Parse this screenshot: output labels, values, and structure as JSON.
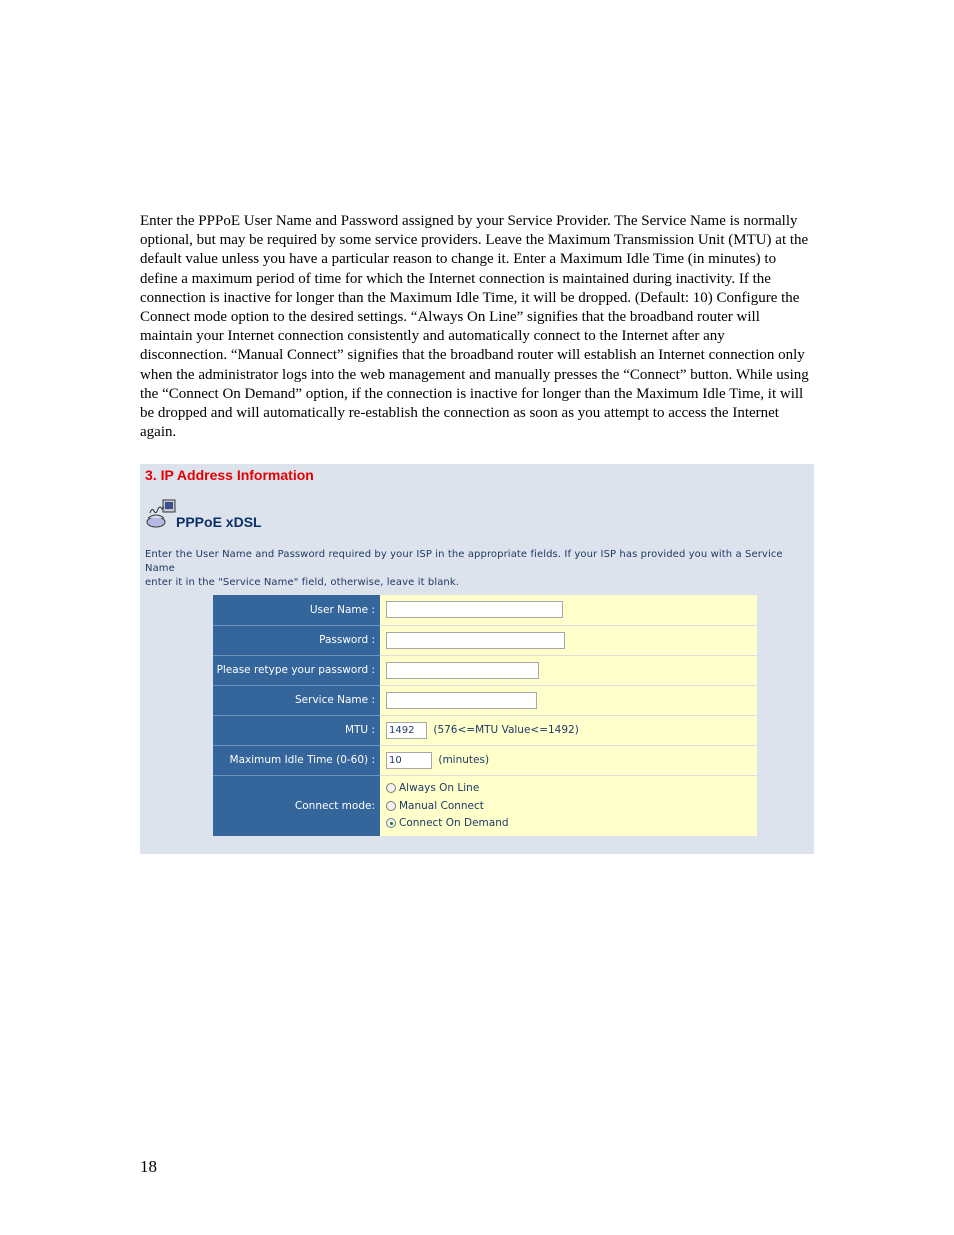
{
  "document": {
    "paragraph": "Enter the PPPoE User Name and Password assigned by your Service Provider. The Service Name is normally optional, but may be required by some service providers. Leave the Maximum Transmission Unit (MTU) at the default value unless you have a particular reason to change it. Enter a Maximum Idle Time (in minutes) to define a maximum period of time for which the Internet connection is maintained during inactivity. If the connection is inactive for longer than the Maximum Idle Time, it will be dropped. (Default: 10) Configure the Connect mode option to the desired settings. “Always On Line” signifies that the broadband router will maintain your Internet connection consistently and automatically connect to the Internet after any disconnection. “Manual Connect” signifies that the broadband router will establish an Internet connection only when the administrator logs into the web management and manually presses the “Connect” button. While using the “Connect On Demand” option, if the connection is inactive for longer than the Maximum Idle Time, it will be dropped and will automatically re-establish the connection as soon as you attempt to access the Internet again.",
    "page_number": "18"
  },
  "panel": {
    "section_title": "3. IP Address Information",
    "icon": "pppoe-modem-phone-icon",
    "pppoe_title": "PPPoE xDSL",
    "intro_line1": "Enter the User Name and Password required by your ISP in the appropriate fields. If your ISP has provided you with a Service Name",
    "intro_line2": "enter it in the \"Service Name\" field, otherwise, leave it blank.",
    "colors": {
      "label_bg": "#34659b",
      "value_bg": "#ffffcc",
      "panel_bg": "#dce3ed",
      "title_red": "#e60000"
    },
    "fields": {
      "user_name": {
        "label": "User Name :",
        "value": ""
      },
      "password": {
        "label": "Password :",
        "value": ""
      },
      "retype_password": {
        "label": "Please retype your password :",
        "value": ""
      },
      "service_name": {
        "label": "Service Name :",
        "value": ""
      },
      "mtu": {
        "label": "MTU :",
        "value": "1492",
        "hint": "(576<=MTU Value<=1492)"
      },
      "idle_time": {
        "label": "Maximum Idle Time (0-60) :",
        "value": "10",
        "hint": "(minutes)"
      },
      "connect_mode": {
        "label": "Connect mode:",
        "options": [
          "Always On Line",
          "Manual Connect",
          "Connect On Demand"
        ],
        "selected": "Connect On Demand"
      }
    }
  }
}
